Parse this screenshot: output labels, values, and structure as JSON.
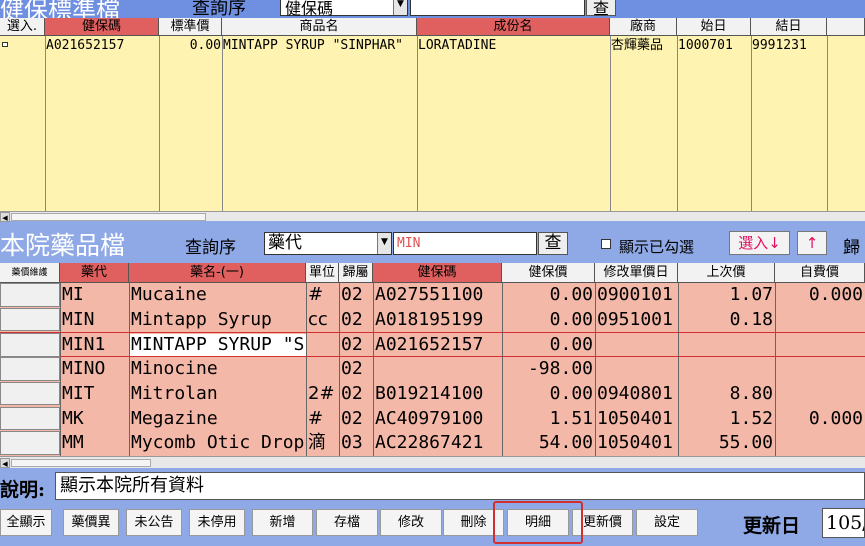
{
  "top": {
    "title": "健保標準檔",
    "query_label": "查詢序",
    "query_select": "健保碼",
    "query_button": "查",
    "columns": [
      "選入.",
      "健保碼",
      "標準價",
      "商品名",
      "成份名",
      "廠商",
      "始日",
      "結日"
    ],
    "row": {
      "code": "A021652157",
      "price": "0.00",
      "product": "MINTAPP SYRUP \"SINPHAR\"",
      "ingredient": "LORATADINE",
      "vendor": "杏輝藥品",
      "start": "1000701",
      "end": "9991231"
    }
  },
  "mid": {
    "title": "本院藥品檔",
    "query_label": "查詢序",
    "query_select": "藥代",
    "query_input": "MIN",
    "query_button": "查",
    "show_checked_label": "顯示已勾選",
    "select_down": "選入↓",
    "select_up": "↑",
    "return_label": "歸"
  },
  "grid2": {
    "columns": [
      "藥價維護",
      "藥代",
      "藥名-(一)",
      "單位",
      "歸屬",
      "健保碼",
      "健保價",
      "修改單價日",
      "上次價",
      "自費價"
    ],
    "rows": [
      {
        "code": "MI",
        "name": "Mucaine",
        "unit": "#",
        "group": "02",
        "nhi": "A027551100",
        "price": "0.00",
        "date": "0900101",
        "last": "1.07",
        "self": "0.000"
      },
      {
        "code": "MIN",
        "name": "Mintapp Syrup",
        "unit": "cc",
        "group": "02",
        "nhi": "A018195199",
        "price": "0.00",
        "date": "0951001",
        "last": "0.18",
        "self": ""
      },
      {
        "code": "MIN1",
        "name": "MINTAPP SYRUP \"SI",
        "unit": "",
        "group": "02",
        "nhi": "A021652157",
        "price": "0.00",
        "date": "",
        "last": "",
        "self": ""
      },
      {
        "code": "MINO",
        "name": "Minocine",
        "unit": "",
        "group": "02",
        "nhi": "",
        "price": "-98.00",
        "date": "",
        "last": "",
        "self": ""
      },
      {
        "code": "MIT",
        "name": "Mitrolan",
        "unit": "2#",
        "group": "02",
        "nhi": "B019214100",
        "price": "0.00",
        "date": "0940801",
        "last": "8.80",
        "self": ""
      },
      {
        "code": "MK",
        "name": "Megazine",
        "unit": "#",
        "group": "02",
        "nhi": "AC40979100",
        "price": "1.51",
        "date": "1050401",
        "last": "1.52",
        "self": "0.000"
      },
      {
        "code": "MM",
        "name": "Mycomb Otic Drop",
        "unit": "滴",
        "group": "03",
        "nhi": "AC22867421",
        "price": "54.00",
        "date": "1050401",
        "last": "55.00",
        "self": ""
      }
    ]
  },
  "note": {
    "label": "說明:",
    "text": "顯示本院所有資料"
  },
  "buttons": [
    "全顯示",
    "藥價異",
    "未公告",
    "未停用",
    "新增",
    "存檔",
    "修改",
    "刪除",
    "明細",
    "更新價",
    "設定"
  ],
  "update": {
    "label": "更新日",
    "value": "105/"
  },
  "colors": {
    "blue_bg": "#8fa9e6",
    "yellow_grid": "#fef3b0",
    "salmon_grid": "#f4b8a8",
    "header_red": "#e06060",
    "highlight": "#d03030"
  }
}
